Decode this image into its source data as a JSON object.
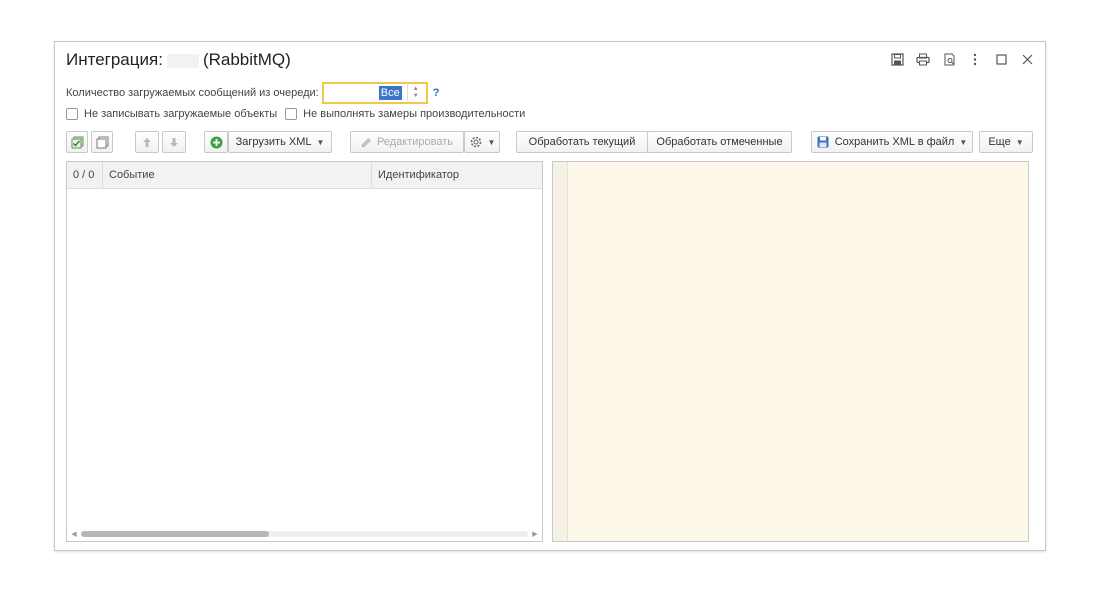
{
  "window": {
    "title_prefix": "Интеграция:",
    "title_suffix": "(RabbitMQ)",
    "buttons": [
      {
        "icon": "save-icon",
        "glyph": "🖫"
      },
      {
        "icon": "print-icon",
        "glyph": "⎙"
      },
      {
        "icon": "preview-icon",
        "glyph": "🔍"
      },
      {
        "icon": "more-vertical-icon",
        "glyph": "⋮"
      },
      {
        "icon": "maximize-icon",
        "glyph": "☐"
      },
      {
        "icon": "close-icon",
        "glyph": "✕"
      }
    ]
  },
  "form": {
    "qty_label": "Количество загружаемых сообщений из очереди:",
    "qty_value": "Все",
    "help": "?",
    "checkbox_no_write": "Не записывать загружаемые объекты",
    "checkbox_no_measure": "Не выполнять замеры производительности"
  },
  "toolbar": {
    "load_xml": "Загрузить XML",
    "edit": "Редактировать",
    "process_current": "Обработать текущий",
    "process_marked": "Обработать отмеченные",
    "save_xml": "Сохранить XML в файл",
    "more": "Еще"
  },
  "grid": {
    "columns": [
      "0 / 0",
      "Событие",
      "Идентификатор"
    ],
    "rows": []
  },
  "colors": {
    "accent_border": "#f2c84b",
    "selection": "#3c74c9",
    "viewer_bg": "#fdf8ea",
    "add_icon": "#3aa246"
  }
}
